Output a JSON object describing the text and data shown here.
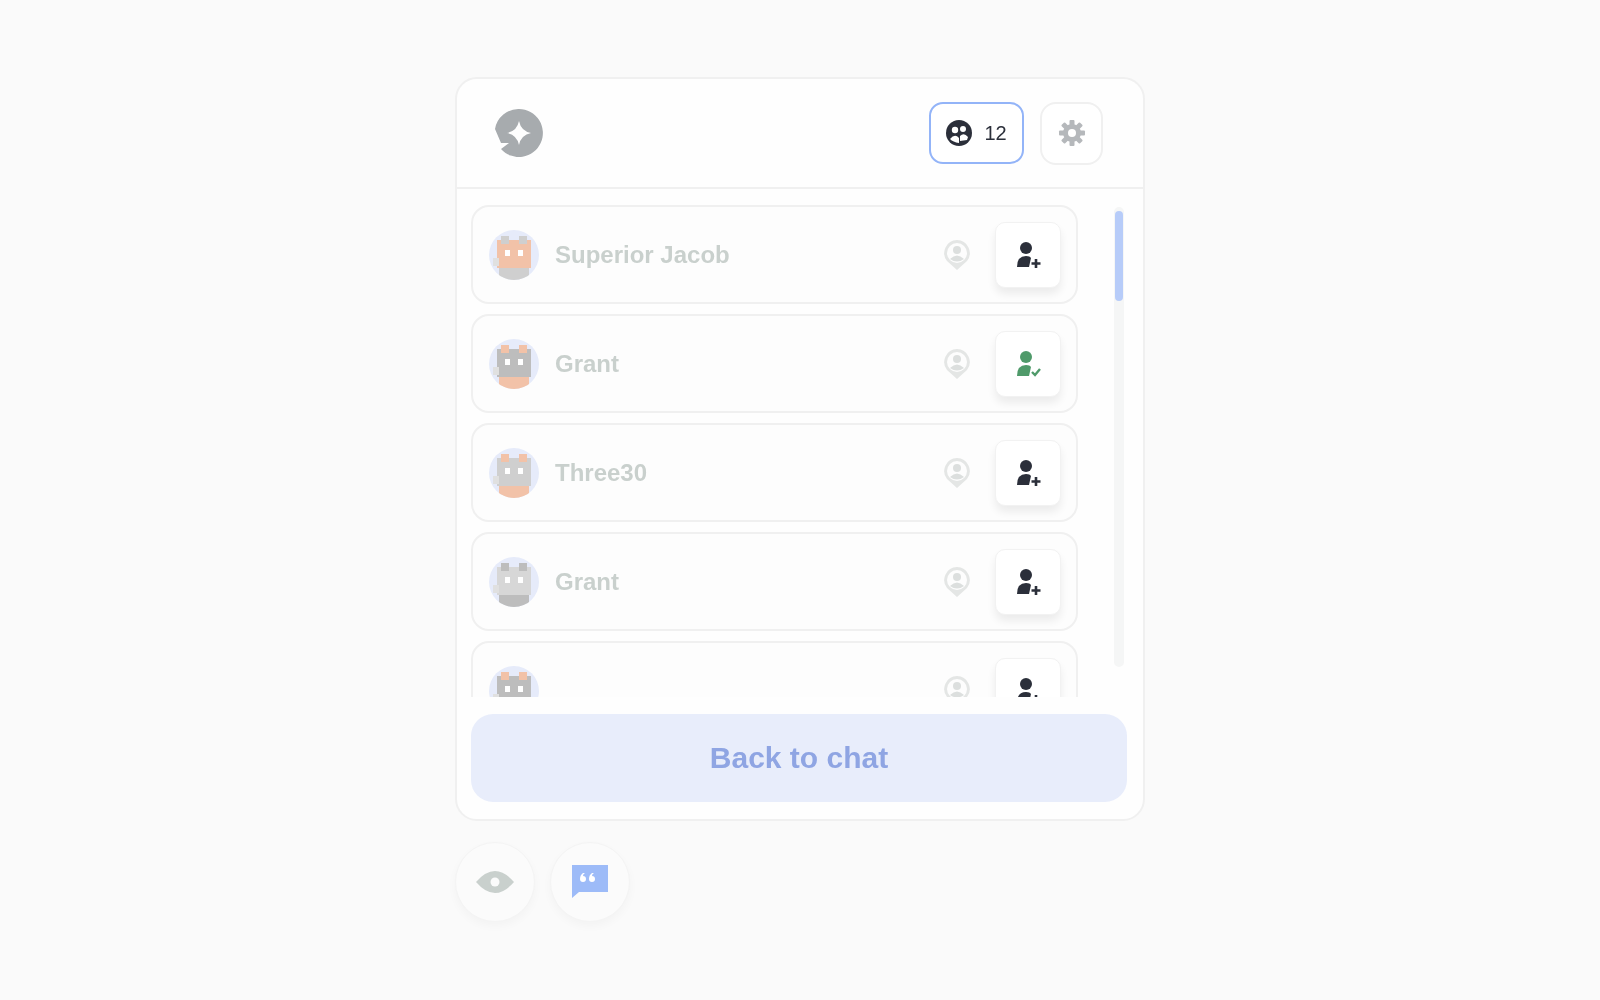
{
  "header": {
    "member_count": "12"
  },
  "members": [
    {
      "name": "Superior Jacob",
      "added": false
    },
    {
      "name": "Grant",
      "added": true
    },
    {
      "name": "Three30",
      "added": false
    },
    {
      "name": "Grant",
      "added": false
    },
    {
      "added": false
    }
  ],
  "footer": {
    "button": "Back to chat"
  },
  "bottom_actions": [
    {
      "kind": "eye"
    },
    {
      "kind": "quote"
    }
  ]
}
